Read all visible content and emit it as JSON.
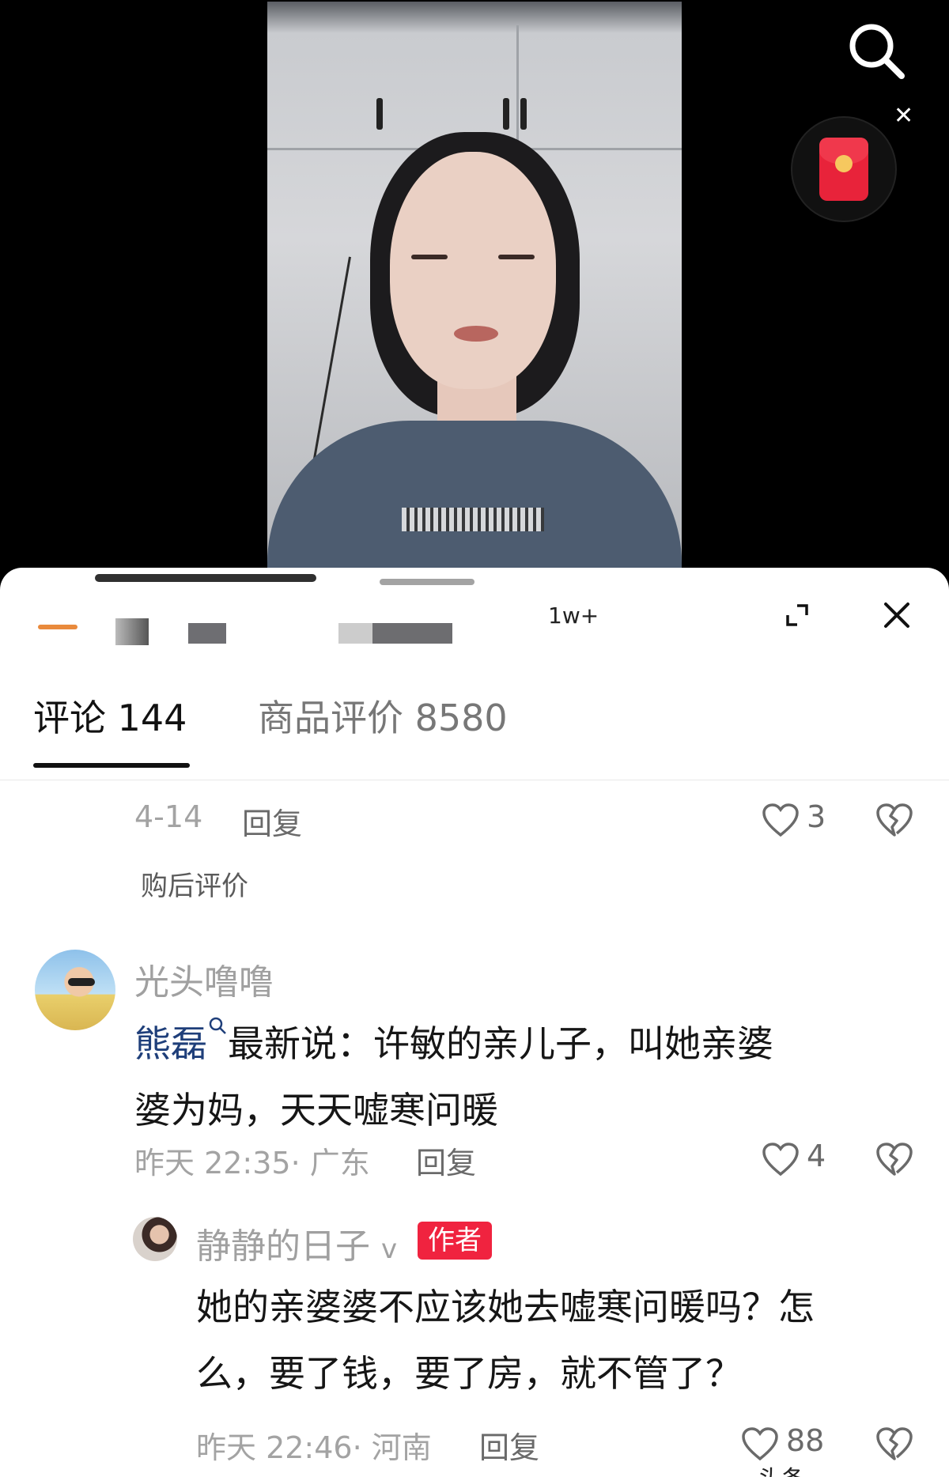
{
  "header": {
    "viewer_count": "1w+"
  },
  "tabs": [
    {
      "label": "评论 144"
    },
    {
      "label": "商品评价 8580"
    }
  ],
  "review_item": {
    "date": "4-14",
    "reply_label": "回复",
    "likes": "3",
    "tag": "购后评价"
  },
  "comment": {
    "username": "光头噜噜",
    "mention": "熊磊",
    "text_line1": "最新说：许敏的亲儿子，叫她亲婆",
    "text_line2": "婆为妈，天天嘘寒问暖",
    "meta": "昨天 22:35· 广东",
    "reply_label": "回复",
    "likes": "4"
  },
  "reply": {
    "username": "静静的日子",
    "verified": "v",
    "badge": "作者",
    "text_line1": "她的亲婆婆不应该她去嘘寒问暖吗？怎",
    "text_line2": "么，要了钱，要了房，就不管了？",
    "meta": "昨天 22:46· 河南",
    "reply_label": "回复",
    "likes": "88"
  },
  "bottom_partial": "头条",
  "icons": {
    "search": "search-icon",
    "red_packet": "red-packet-icon",
    "close": "close-icon",
    "expand": "expand-icon",
    "like": "heart-icon",
    "dislike": "broken-heart-icon"
  },
  "colors": {
    "author_badge": "#f0233f",
    "mention": "#1f3f7a",
    "meta_gray": "#a3a3a3"
  }
}
